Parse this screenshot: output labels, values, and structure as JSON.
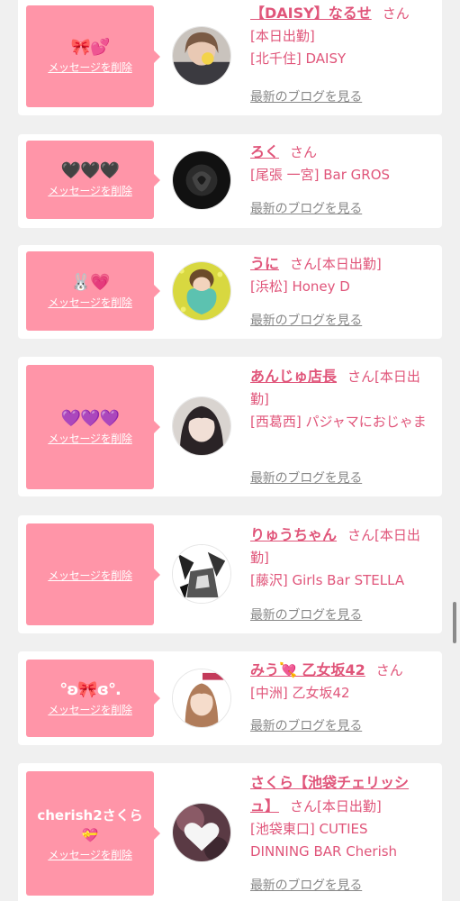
{
  "common": {
    "delete_label": "メッセージを削除",
    "blog_label": "最新のブログを見る",
    "san": "さん"
  },
  "entries": [
    {
      "message": "🎀💕",
      "name": "【DAISY】なるせ",
      "suffix": "",
      "shop": "[北千住] DAISY",
      "status": "[本日出勤]"
    },
    {
      "message": "🖤🖤🖤",
      "name": "ろく",
      "suffix": "",
      "shop": "[尾張 一宮] Bar GROS",
      "status": ""
    },
    {
      "message": "🐰💗",
      "name": "うに",
      "suffix": "[本日出勤]",
      "shop": "[浜松] Honey D",
      "status": ""
    },
    {
      "message": "💜💜💜",
      "name": "あんじゅ店長",
      "suffix": "[本日出勤]",
      "shop": "[西葛西] パジャマにおじゃま",
      "status": ""
    },
    {
      "message": "",
      "name": "りゅうちゃん",
      "suffix": "[本日出勤]",
      "shop": "[藤沢] Girls Bar STELLA",
      "status": ""
    },
    {
      "message": "°ʚ🎀ɞ°.",
      "name": "みう💘 乙女坂42",
      "suffix": "",
      "shop": "[中洲] 乙女坂42",
      "status": ""
    },
    {
      "message": "cherish2さくら💝",
      "name": "さくら【池袋チェリッシュ】",
      "suffix": "[本日出勤]",
      "shop": "[池袋東口] CUTIES DINNING BAR Cherish",
      "status": ""
    }
  ],
  "colors": {
    "accent": "#e0557a",
    "message_bg": "#ff95a8",
    "card_bg": "#ffffff",
    "page_bg": "#f0f0f0",
    "link_gray": "#888888"
  }
}
